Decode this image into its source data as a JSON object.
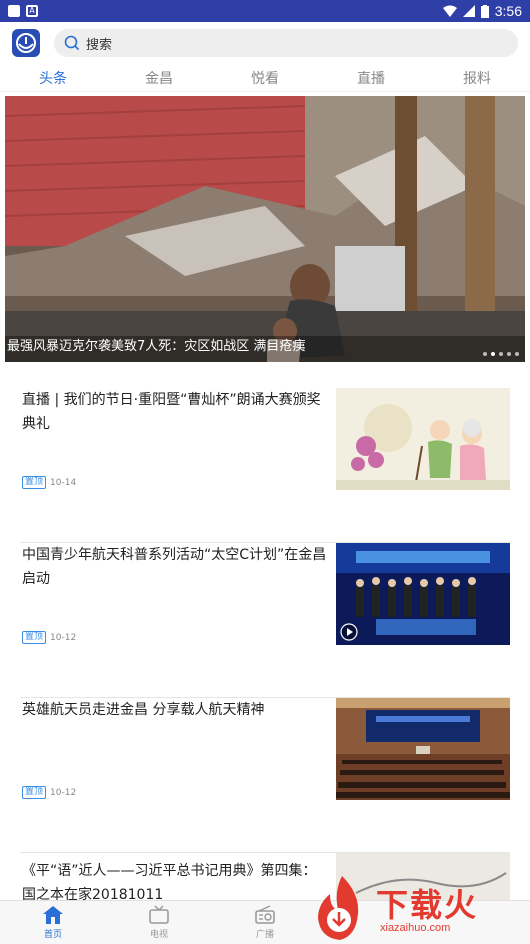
{
  "status_bar": {
    "time": "3:56"
  },
  "header": {
    "search_placeholder": "搜索"
  },
  "tabs": [
    {
      "label": "头条",
      "active": true
    },
    {
      "label": "金昌",
      "active": false
    },
    {
      "label": "悦看",
      "active": false
    },
    {
      "label": "直播",
      "active": false
    },
    {
      "label": "报料",
      "active": false
    }
  ],
  "hero": {
    "caption": "最强风暴迈克尔袭美致7人死：灾区如战区 满目疮痍",
    "slide_count": 5,
    "active_slide": 1
  },
  "news": [
    {
      "title": "直播 | 我们的节日·重阳暨“曹灿杯”朗诵大赛颁奖典礼",
      "tag": "置顶",
      "date": "10-14",
      "thumb": "elderly-couple-illustration"
    },
    {
      "title": "中国青少年航天科普系列活动“太空C计划”在金昌启动",
      "tag": "置顶",
      "date": "10-12",
      "thumb": "space-c-plan-stage",
      "has_video": true
    },
    {
      "title": "英雄航天员走进金昌 分享载人航天精神",
      "tag": "置顶",
      "date": "10-12",
      "thumb": "auditorium-event"
    },
    {
      "title": "《平“语”近人——习近平总书记用典》第四集：国之本在家20181011",
      "thumb": "ink-painting"
    }
  ],
  "bottom_nav": [
    {
      "label": "首页",
      "icon": "home-icon",
      "active": true
    },
    {
      "label": "电视",
      "icon": "tv-icon",
      "active": false
    },
    {
      "label": "广播",
      "icon": "radio-icon",
      "active": false
    }
  ],
  "watermark": {
    "text": "下载火",
    "url": "xiazaihuo.com"
  },
  "colors": {
    "status_bar": "#2f3fa8",
    "accent": "#2a6fd6",
    "tag": "#3a8ee6",
    "watermark": "#e23a2e"
  }
}
